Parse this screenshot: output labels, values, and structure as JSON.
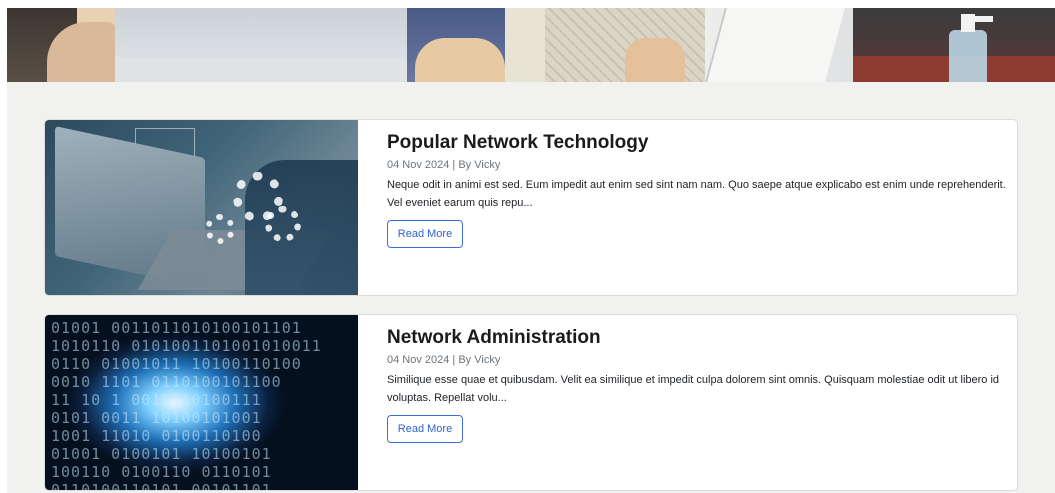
{
  "posts": [
    {
      "title": "Popular Network Technology",
      "meta": "04 Nov 2024 | By Vicky",
      "excerpt": "Neque odit in animi est sed. Eum impedit aut enim sed sint nam nam. Quo saepe atque explicabo est enim unde reprehenderit. Vel eveniet earum quis repu...",
      "button_label": "Read More"
    },
    {
      "title": "Network Administration",
      "meta": "04 Nov 2024 | By Vicky",
      "excerpt": "Similique esse quae et quibusdam. Velit ea similique et impedit culpa dolorem sint omnis. Quisquam molestiae odit ut libero id voluptas. Repellat volu...",
      "button_label": "Read More"
    }
  ]
}
